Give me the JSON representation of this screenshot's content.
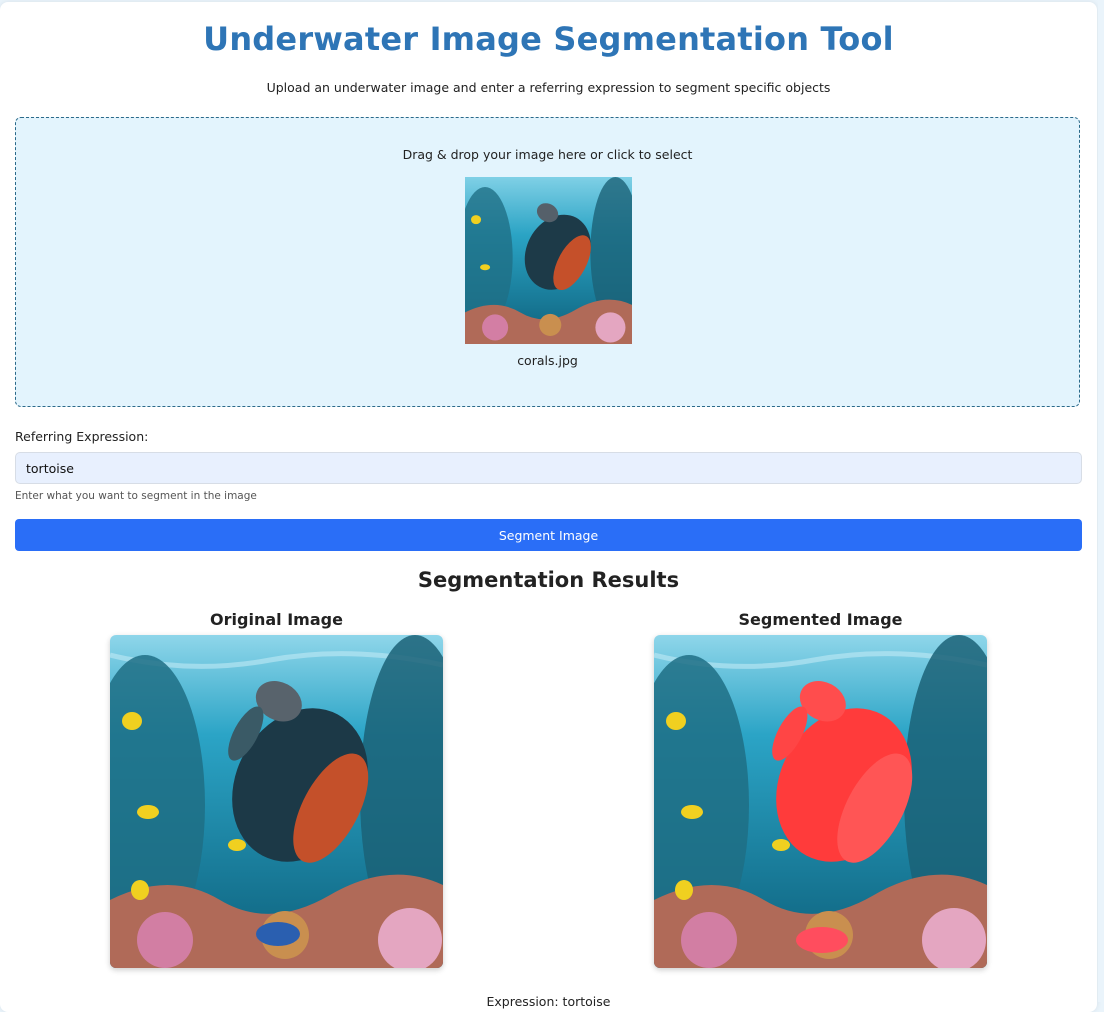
{
  "header": {
    "title": "Underwater Image Segmentation Tool",
    "subtitle": "Upload an underwater image and enter a referring expression to segment specific objects"
  },
  "upload": {
    "prompt": "Drag & drop your image here or click to select",
    "filename": "corals.jpg"
  },
  "form": {
    "label": "Referring Expression:",
    "value": "tortoise",
    "hint": "Enter what you want to segment in the image",
    "button": "Segment Image"
  },
  "results": {
    "title": "Segmentation Results",
    "original_title": "Original Image",
    "segmented_title": "Segmented Image",
    "expression_line": "Expression: tortoise"
  },
  "colors": {
    "title": "#2e75b6",
    "button": "#2a6ef7",
    "dropzone_bg": "#e3f4fd",
    "input_bg": "#e8f0fe",
    "mask": "#ff3b3b"
  }
}
